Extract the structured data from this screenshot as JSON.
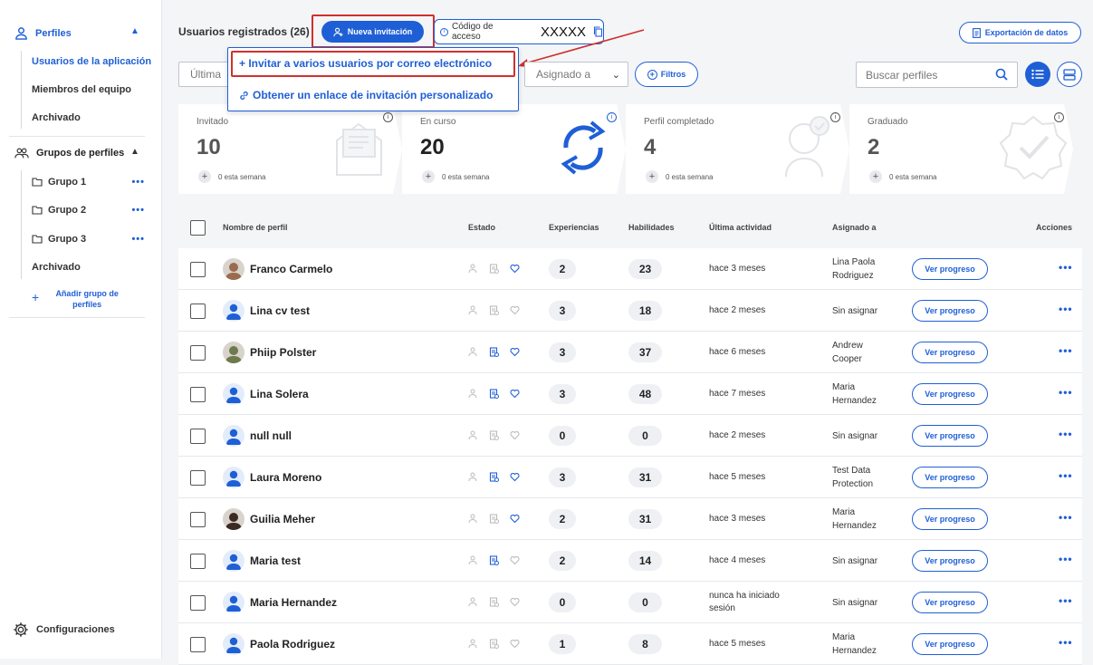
{
  "sidebar": {
    "profiles_label": "Perfiles",
    "items": [
      "Usuarios de la aplicación",
      "Miembros del equipo",
      "Archivado"
    ],
    "groups_label": "Grupos de perfiles",
    "groups": [
      "Grupo 1",
      "Grupo 2",
      "Grupo 3"
    ],
    "groups_archived": "Archivado",
    "add_group": "Añadir grupo de perfiles",
    "settings": "Configuraciones"
  },
  "header": {
    "title": "Usuarios registrados (26)",
    "new_invite": "Nueva invitación",
    "access_code_label": "Código de acceso",
    "access_code_value": "XXXXX",
    "export": "Exportación de datos"
  },
  "filters": {
    "last_activity": "Última",
    "assigned": "Asignado a",
    "filters_btn": "Filtros",
    "search_placeholder": "Buscar perfiles"
  },
  "dropdown": {
    "option1": "+ Invitar a varios usuarios por correo electrónico",
    "option2": "Obtener un enlace de invitación personalizado"
  },
  "cards": [
    {
      "label": "Invitado",
      "value": "10",
      "week": "0 esta semana"
    },
    {
      "label": "En curso",
      "value": "20",
      "week": "0 esta semana"
    },
    {
      "label": "Perfil completado",
      "value": "4",
      "week": "0 esta semana"
    },
    {
      "label": "Graduado",
      "value": "2",
      "week": "0 esta semana"
    }
  ],
  "table": {
    "headers": {
      "name": "Nombre de perfil",
      "status": "Estado",
      "exp": "Experiencias",
      "skills": "Habilidades",
      "activity": "Última actividad",
      "assigned": "Asignado a",
      "actions": "Acciones"
    },
    "progress_label": "Ver progreso",
    "rows": [
      {
        "name": "Franco Carmelo",
        "exp": "2",
        "skills": "23",
        "activity": "hace 3 meses",
        "assigned": "Lina Paola Rodriguez",
        "photo": true
      },
      {
        "name": "Lina cv test",
        "exp": "3",
        "skills": "18",
        "activity": "hace 2 meses",
        "assigned": "Sin asignar",
        "photo": false
      },
      {
        "name": "Phiip Polster",
        "exp": "3",
        "skills": "37",
        "activity": "hace 6 meses",
        "assigned": "Andrew Cooper",
        "photo": true
      },
      {
        "name": "Lina Solera",
        "exp": "3",
        "skills": "48",
        "activity": "hace 7 meses",
        "assigned": "Maria Hernandez",
        "photo": false
      },
      {
        "name": "null null",
        "exp": "0",
        "skills": "0",
        "activity": "hace 2 meses",
        "assigned": "Sin asignar",
        "photo": false
      },
      {
        "name": "Laura Moreno",
        "exp": "3",
        "skills": "31",
        "activity": "hace 5 meses",
        "assigned": "Test Data Protection",
        "photo": false
      },
      {
        "name": "Guilia Meher",
        "exp": "2",
        "skills": "31",
        "activity": "hace 3 meses",
        "assigned": "Maria Hernandez",
        "photo": true
      },
      {
        "name": "Maria test",
        "exp": "2",
        "skills": "14",
        "activity": "hace 4 meses",
        "assigned": "Sin asignar",
        "photo": false
      },
      {
        "name": "Maria Hernandez",
        "exp": "0",
        "skills": "0",
        "activity": "nunca ha iniciado sesión",
        "assigned": "Sin asignar",
        "photo": false
      },
      {
        "name": "Paola Rodriguez",
        "exp": "1",
        "skills": "8",
        "activity": "hace 5 meses",
        "assigned": "Maria Hernandez",
        "photo": false
      }
    ]
  },
  "colors": {
    "accent": "#1f5fd6",
    "highlight": "#d0302c"
  }
}
